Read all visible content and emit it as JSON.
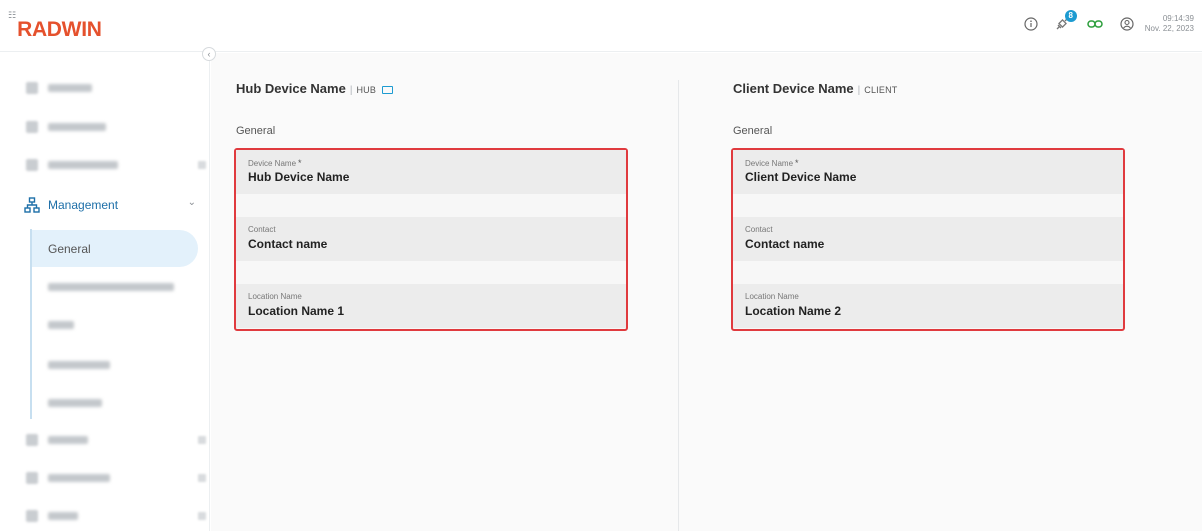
{
  "brand": {
    "logo_mark": "☷",
    "name": "RADWIN"
  },
  "header": {
    "notification_count": "8",
    "time": "09:14:39",
    "date": "Nov. 22, 2023",
    "icons": [
      "info-icon",
      "satellite-icon",
      "link-icon",
      "user-icon"
    ]
  },
  "sidebar": {
    "collapse_glyph": "‹",
    "management_label": "Management",
    "active_sub_item": "General"
  },
  "hub": {
    "title": "Hub Device Name",
    "separator": "|",
    "role": "HUB",
    "section": "General",
    "fields": [
      {
        "label": "Device Name",
        "required_mark": "*",
        "value": "Hub Device Name"
      },
      {
        "label": "Contact",
        "value": "Contact name"
      },
      {
        "label": "Location Name",
        "value": "Location Name 1"
      }
    ]
  },
  "client": {
    "title": "Client Device Name",
    "separator": "|",
    "role": "CLIENT",
    "section": "General",
    "fields": [
      {
        "label": "Device Name",
        "required_mark": "*",
        "value": "Client Device Name"
      },
      {
        "label": "Contact",
        "value": "Contact name"
      },
      {
        "label": "Location Name",
        "value": "Location Name 2"
      }
    ]
  },
  "colors": {
    "brand": "#e5512d",
    "accent": "#1d6fa8",
    "highlight_border": "#e03a3e",
    "active_bg": "#e3f1fb",
    "link_green": "#2a9d3a"
  }
}
